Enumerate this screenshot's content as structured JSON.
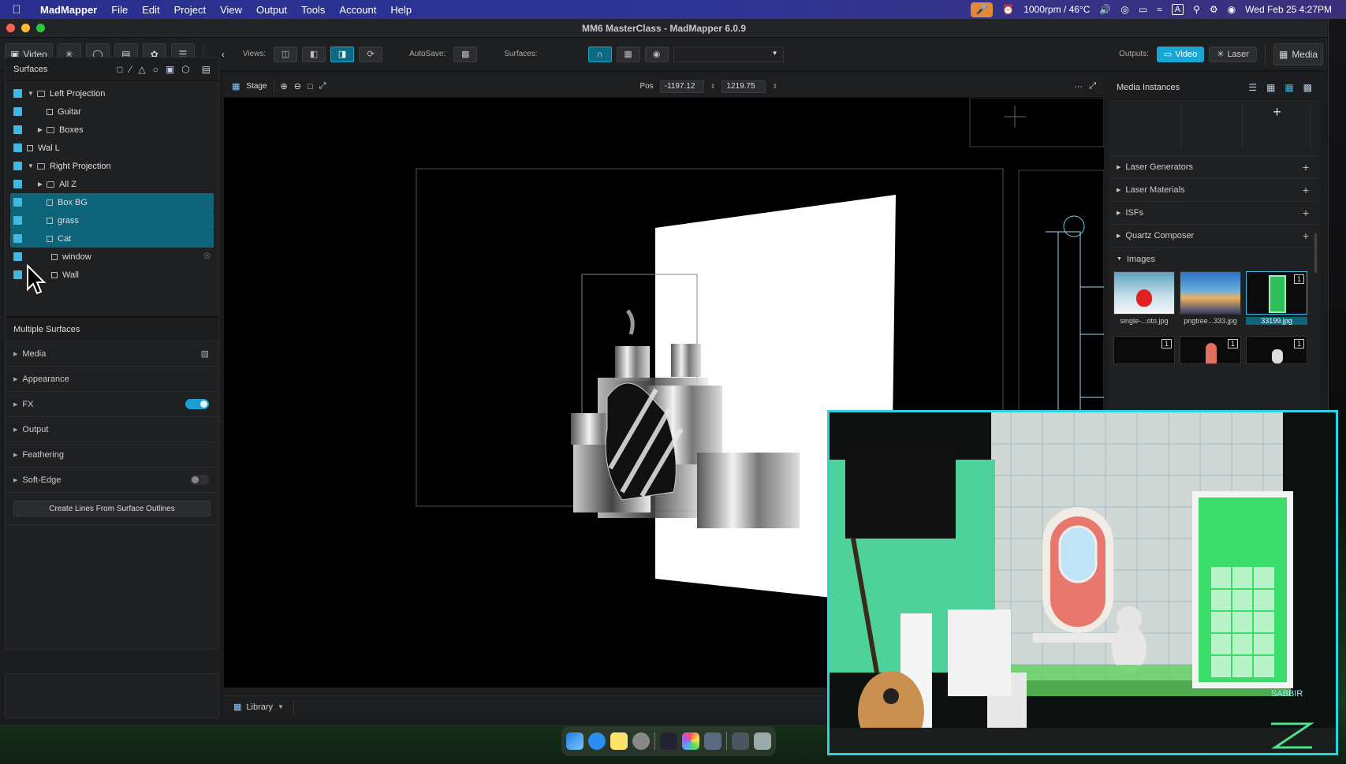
{
  "menubar": {
    "app": "MadMapper",
    "items": [
      "File",
      "Edit",
      "Project",
      "View",
      "Output",
      "Tools",
      "Account",
      "Help"
    ],
    "fan_status": "1000rpm / 46°C",
    "input_badge": "A",
    "datetime": "Wed Feb 25  4:27PM"
  },
  "window": {
    "title": "MM6 MasterClass - MadMapper 6.0.9"
  },
  "toolbar": {
    "video_label": "Video",
    "views_label": "Views:",
    "autosave_label": "AutoSave:",
    "surfaces_label": "Surfaces:",
    "outputs_label": "Outputs:",
    "output_video": "Video",
    "output_laser": "Laser",
    "media_label": "Media"
  },
  "surfaces": {
    "header": "Surfaces",
    "items": [
      {
        "label": "Left Projection",
        "type": "folder",
        "expanded": true,
        "level": 0,
        "selected": false
      },
      {
        "label": "Guitar",
        "type": "surface",
        "level": 1,
        "selected": false
      },
      {
        "label": "Boxes",
        "type": "folder",
        "expanded": false,
        "level": 1,
        "selected": false
      },
      {
        "label": "Wal L",
        "type": "surface",
        "level": 0,
        "selected": false
      },
      {
        "label": "Right Projection",
        "type": "folder",
        "expanded": true,
        "level": 0,
        "selected": false
      },
      {
        "label": "All Z",
        "type": "folder",
        "expanded": false,
        "level": 1,
        "selected": false
      },
      {
        "label": "Box BG",
        "type": "surface",
        "level": 1,
        "selected": true
      },
      {
        "label": "grass",
        "type": "surface",
        "level": 1,
        "selected": true
      },
      {
        "label": "Cat",
        "type": "surface",
        "level": 1,
        "selected": true
      },
      {
        "label": "window",
        "type": "surface",
        "level": 1,
        "selected": false,
        "locked": true
      },
      {
        "label": "Wall",
        "type": "surface",
        "level": 1,
        "selected": false
      }
    ]
  },
  "properties": {
    "header": "Multiple Surfaces",
    "sections": [
      {
        "label": "Media"
      },
      {
        "label": "Appearance"
      },
      {
        "label": "FX",
        "toggle": "on"
      },
      {
        "label": "Output"
      },
      {
        "label": "Feathering"
      },
      {
        "label": "Soft-Edge",
        "toggle": "off"
      }
    ],
    "button": "Create Lines From Surface Outlines"
  },
  "stage": {
    "tab": "Stage",
    "pos_label": "Pos",
    "pos_x": "-1197.12",
    "pos_y": "1219.75",
    "more": "···"
  },
  "library": {
    "label": "Library"
  },
  "media": {
    "header": "Media Instances",
    "sections": [
      "Laser Generators",
      "Laser Materials",
      "ISFs",
      "Quartz Composer",
      "Images"
    ],
    "images": [
      {
        "caption": "single-...oto.jpg"
      },
      {
        "caption": "pngtree...333.jpg"
      },
      {
        "caption": "33199.jpg",
        "badge": "1"
      }
    ],
    "badges_row2": [
      "1",
      "1",
      "1"
    ]
  },
  "overlay": {
    "watermark": "SABBIR"
  },
  "colors": {
    "accent": "#1aa7d4",
    "selection": "#0e6478",
    "checkbox": "#3fb8e3",
    "camera_border": "#29d3e0"
  }
}
